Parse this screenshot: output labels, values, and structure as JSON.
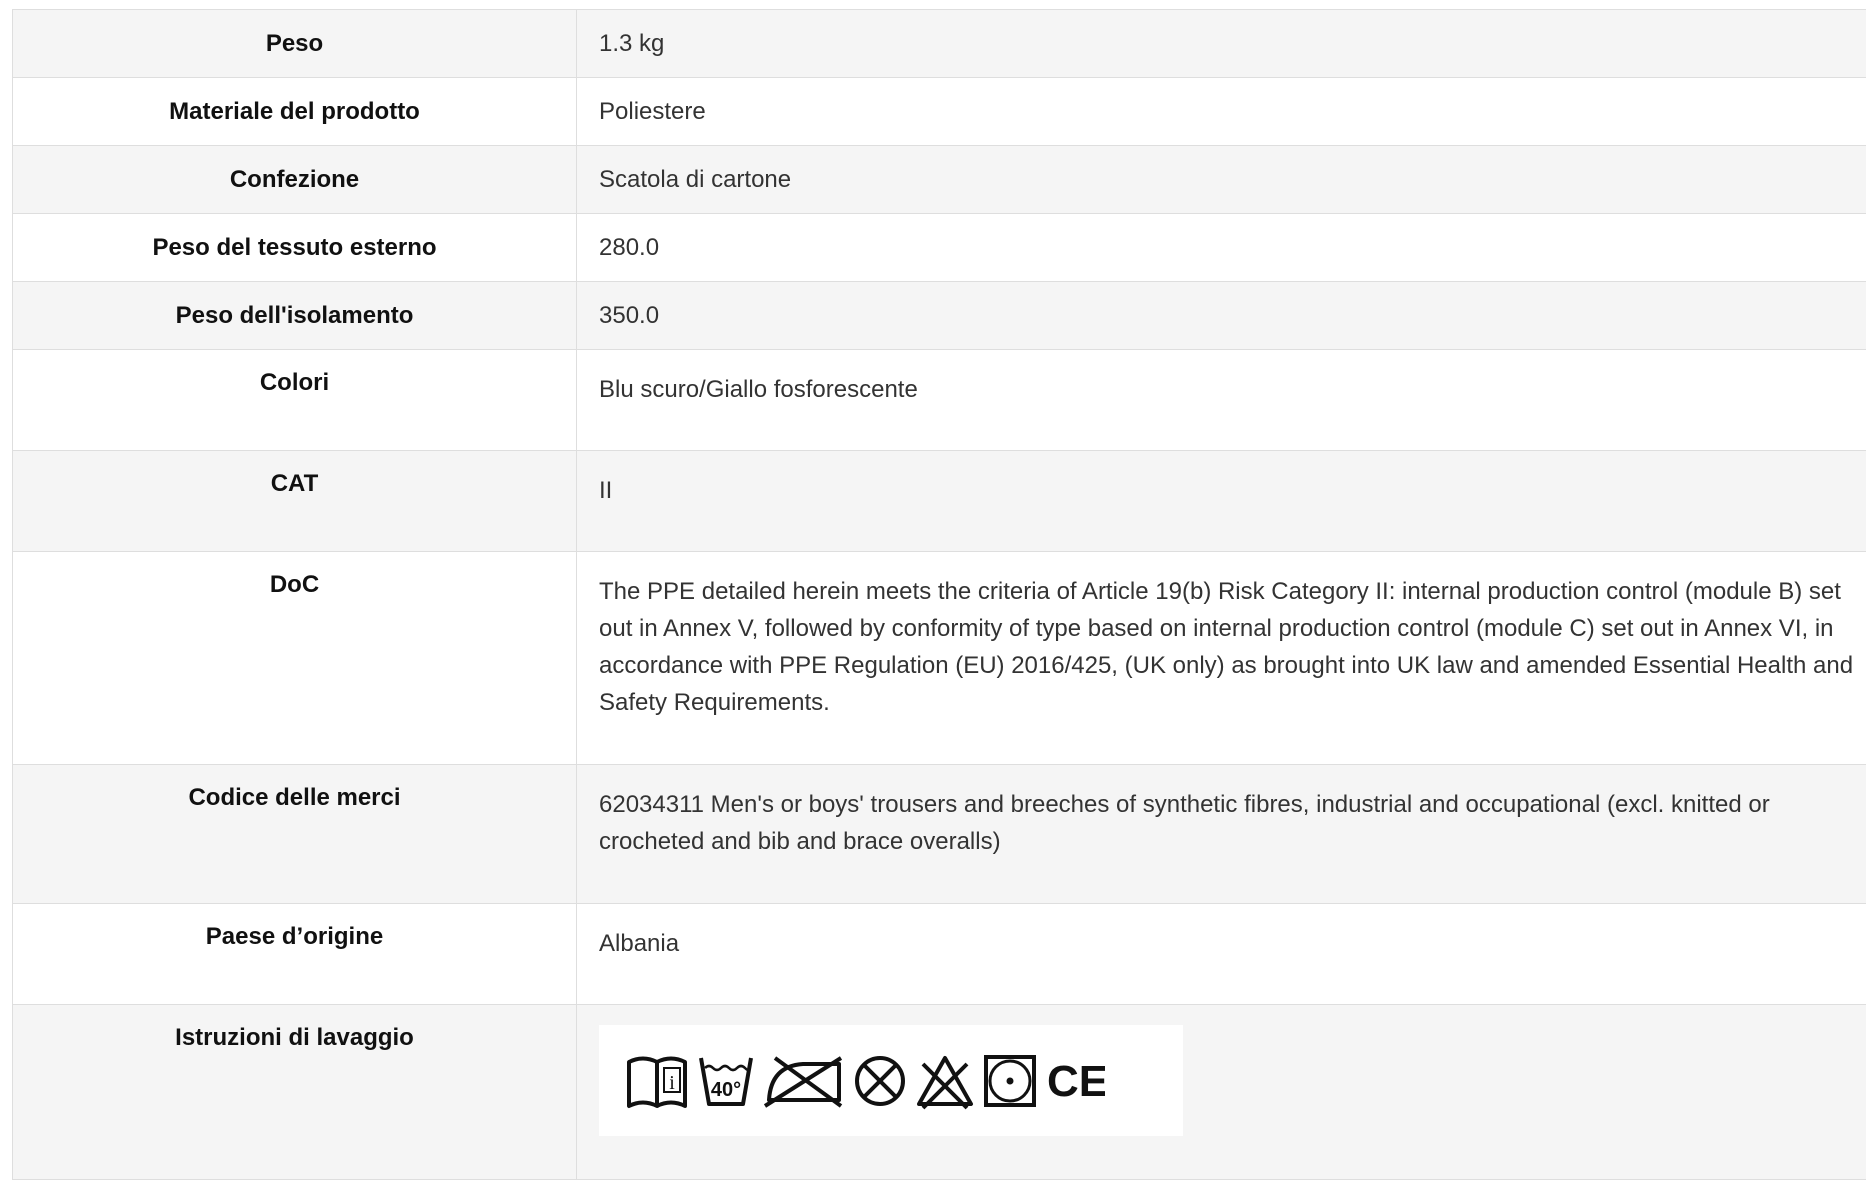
{
  "rows": [
    {
      "label": "Peso",
      "value": "1.3 kg"
    },
    {
      "label": "Materiale del prodotto",
      "value": "Poliestere"
    },
    {
      "label": "Confezione",
      "value": "Scatola di cartone"
    },
    {
      "label": "Peso del tessuto esterno",
      "value": "280.0"
    },
    {
      "label": "Peso dell'isolamento",
      "value": "350.0"
    },
    {
      "label": "Colori",
      "value": "Blu scuro/Giallo fosforescente"
    },
    {
      "label": "CAT",
      "value": "II"
    },
    {
      "label": "DoC",
      "value": "The PPE detailed herein meets the criteria of Article 19(b) Risk Category II: internal production control (module B) set out in Annex V, followed by conformity of type based on internal production control (module C) set out in Annex VI, in accordance with PPE Regulation (EU) 2016/425, (UK only) as brought into UK law and amended Essential Health and Safety Requirements."
    },
    {
      "label": "Codice delle merci",
      "value": "62034311 Men's or boys' trousers and breeches of synthetic fibres, industrial and occupational (excl. knitted or crocheted and bib and brace overalls)"
    },
    {
      "label": "Paese d’origine",
      "value": "Albania"
    },
    {
      "label": "Istruzioni di lavaggio"
    }
  ],
  "care_symbols": {
    "wash_temperature": "40°",
    "mark": "CE",
    "icons": [
      "read-instructions-icon",
      "wash-40-icon",
      "do-not-iron-icon",
      "do-not-tumble-dry-icon",
      "do-not-bleach-icon",
      "dry-clean-icon",
      "ce-mark-icon"
    ]
  }
}
